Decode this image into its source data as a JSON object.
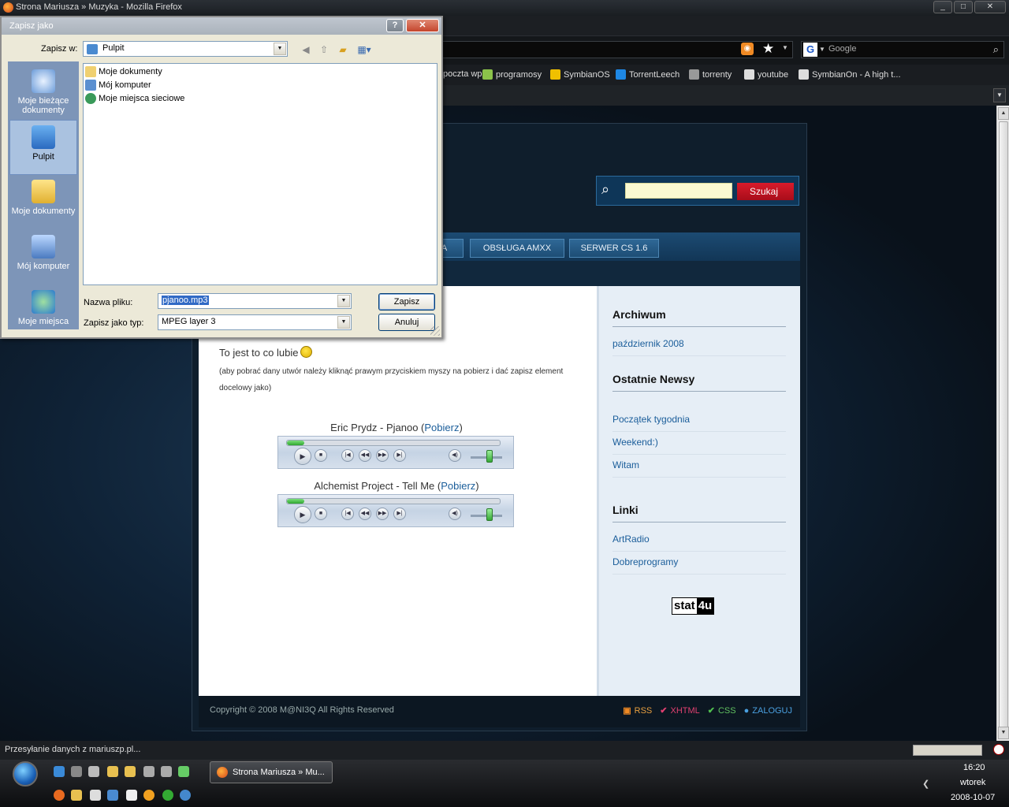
{
  "window": {
    "title": "Strona Mariusza » Muzyka - Mozilla Firefox"
  },
  "toolbar": {
    "search_engine_placeholder": "Google"
  },
  "bookmarks": [
    {
      "label": "poczta wp",
      "color": "#d0d0d0"
    },
    {
      "label": "programosy",
      "color": "#8bc34a"
    },
    {
      "label": "SymbianOS",
      "color": "#f0c000"
    },
    {
      "label": "TorrentLeech",
      "color": "#1e88e5"
    },
    {
      "label": "torrenty",
      "color": "#999999"
    },
    {
      "label": "youtube",
      "color": "#dddddd"
    },
    {
      "label": "SymbianOn - A high t...",
      "color": "#dddddd"
    }
  ],
  "site": {
    "search_button": "Szukaj",
    "nav": [
      {
        "label": "A"
      },
      {
        "label": "OBSŁUGA AMXX"
      },
      {
        "label": "SERWER CS 1.6"
      }
    ],
    "intro": "To jest to co lubie",
    "note": "(aby pobrać dany utwór należy kliknąć prawym przyciskiem myszy na pobierz i dać zapisz element docelowy jako)",
    "tracks": [
      {
        "title": "Eric Prydz - Pjanoo",
        "link": "Pobierz",
        "progress": 0.08
      },
      {
        "title": "Alchemist Project - Tell Me",
        "link": "Pobierz",
        "progress": 0.08
      }
    ],
    "sidebar": {
      "archive_title": "Archiwum",
      "archive_items": [
        "październik 2008"
      ],
      "news_title": "Ostatnie Newsy",
      "news_items": [
        "Początek tygodnia",
        "Weekend:)",
        "Witam"
      ],
      "links_title": "Linki",
      "link_items": [
        "ArtRadio",
        "Dobreprogramy"
      ],
      "stat_logo_a": "stat",
      "stat_logo_b": "4u"
    },
    "footer": {
      "copyright": "Copyright © 2008 M@NI3Q All Rights Reserved",
      "rss": "RSS",
      "xhtml": "XHTML",
      "css": "CSS",
      "login": "ZALOGUJ"
    }
  },
  "status": {
    "text": "Przesyłanie danych z mariuszp.pl..."
  },
  "taskbar": {
    "task": "Strona Mariusza » Mu...",
    "time": "16:20",
    "day": "wtorek",
    "date": "2008-10-07"
  },
  "dialog": {
    "title": "Zapisz jako",
    "save_in_label": "Zapisz w:",
    "save_in_value": "Pulpit",
    "places": [
      {
        "label": "Moje bieżące dokumenty",
        "icon": "recent-documents-icon",
        "selected": false
      },
      {
        "label": "Pulpit",
        "icon": "desktop-icon",
        "selected": true
      },
      {
        "label": "Moje dokumenty",
        "icon": "my-documents-icon",
        "selected": false
      },
      {
        "label": "Mój komputer",
        "icon": "my-computer-icon",
        "selected": false
      },
      {
        "label": "Moje miejsca",
        "icon": "network-places-icon",
        "selected": false
      }
    ],
    "files": [
      {
        "label": "Moje dokumenty",
        "icon": "folder-icon",
        "color": "#f0d070"
      },
      {
        "label": "Mój komputer",
        "icon": "computer-icon",
        "color": "#5a8fd0"
      },
      {
        "label": "Moje miejsca sieciowe",
        "icon": "network-icon",
        "color": "#3a9a5a"
      }
    ],
    "filename_label": "Nazwa pliku:",
    "filename_value": "pjanoo.mp3",
    "filetype_label": "Zapisz jako typ:",
    "filetype_value": "MPEG layer 3",
    "save_button": "Zapisz",
    "cancel_button": "Anuluj"
  }
}
